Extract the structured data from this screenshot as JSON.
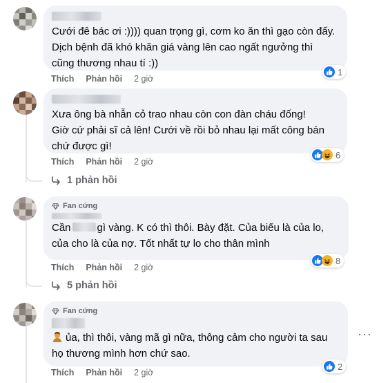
{
  "actions": {
    "like": "Thích",
    "reply": "Phản hồi"
  },
  "badge_label": "Fan cứng",
  "comments": [
    {
      "text_lines": [
        "Cưới đê bác ơi :)))) quan trọng gì, cơm ko ăn thì gạo còn đấy.",
        "Dịch bệnh đã khó khăn giá vàng lên cao ngất ngưởng thì",
        "cũng thương nhau tí :))"
      ],
      "time": "2 giờ",
      "reaction_count": "1",
      "reactions": [
        "like"
      ]
    },
    {
      "text_lines": [
        "Xưa ông bà nhẫn cỏ trao nhau còn con đàn cháu đống!",
        "Giờ cứ phải sĩ cả lên! Cưới về rồi bỏ nhau lại mất công bán",
        "chứ được gì!"
      ],
      "time": "2 giờ",
      "reaction_count": "6",
      "reactions": [
        "like",
        "haha"
      ],
      "replies_label": "1 phản hồi"
    },
    {
      "text_prefix": "Cần",
      "text_line1_rest": "gì vàng. K có thì thôi. Bày đặt. Của biếu là của lo,",
      "text_line2": "của cho là của nợ. Tốt nhất tự lo cho thân mình",
      "time": "2 giờ",
      "reaction_count": "8",
      "reactions": [
        "like",
        "haha"
      ],
      "replies_label": "5 phản hồi"
    },
    {
      "text_line1": "ủa, thì thôi, vàng mã gì nữa, thông cảm cho người ta sau",
      "text_line2": "họ thương mình hơn chứ sao.",
      "time": "2 giờ",
      "reaction_count": "2",
      "reactions": [
        "like"
      ],
      "more": "···"
    }
  ],
  "colors": {
    "like_blue": "#1877f2",
    "haha_yellow": "#f7b125",
    "bubble_bg": "#f0f2f5",
    "meta_gray": "#65676b"
  }
}
